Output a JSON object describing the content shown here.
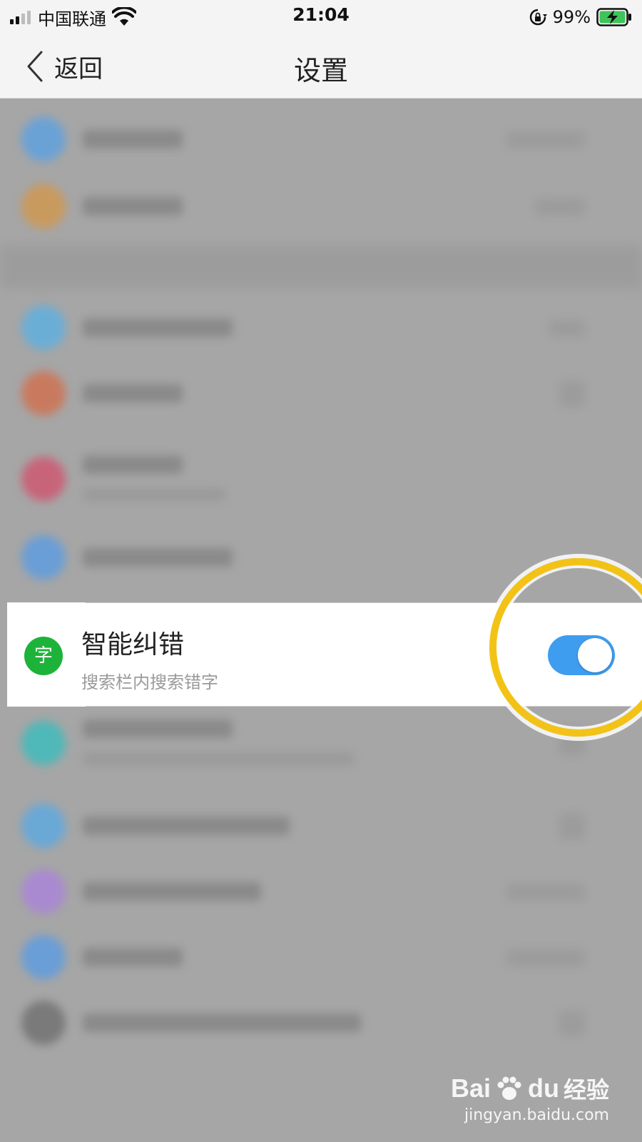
{
  "status_bar": {
    "carrier": "中国联通",
    "time": "21:04",
    "battery_percent": "99%"
  },
  "nav": {
    "back_label": "返回",
    "title": "设置"
  },
  "setting": {
    "icon_glyph": "字",
    "title": "智能纠错",
    "subtitle": "搜索栏内搜索错字",
    "toggle_on": true
  },
  "colors": {
    "toggle_on": "#3f9df0",
    "icon_green": "#1db33a",
    "highlight_ring": "#f2c316"
  },
  "watermark": {
    "brand": "Bai",
    "brand_suffix": "du",
    "product": "经验",
    "url": "jingyan.baidu.com"
  }
}
